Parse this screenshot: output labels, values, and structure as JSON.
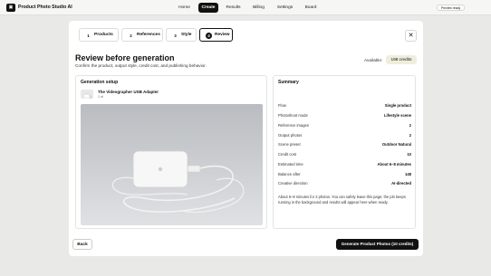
{
  "app": {
    "logo_glyph": "▣",
    "name": "Product Photo Studio AI"
  },
  "nav": [
    {
      "label": "Home"
    },
    {
      "label": "Create"
    },
    {
      "label": "Results"
    },
    {
      "label": "Billing"
    },
    {
      "label": "Settings"
    },
    {
      "label": "Board"
    }
  ],
  "preview_ready": "Preview ready",
  "steps": [
    {
      "num": "1",
      "label": "Products"
    },
    {
      "num": "2",
      "label": "References"
    },
    {
      "num": "3",
      "label": "Style"
    },
    {
      "num": "4",
      "label": "Review"
    }
  ],
  "close_glyph": "✕",
  "page": {
    "title": "Review before generation",
    "subtitle": "Confirm the product, output style, credit cost, and publishing behavior.",
    "available_label": "Available:",
    "available_credits": "198 credits"
  },
  "generation_setup": {
    "title": "Generation setup",
    "product_name": "The Videographer USB Adapter",
    "product_sub": "1 of"
  },
  "summary": {
    "title": "Summary",
    "rows": [
      {
        "key": "Flow",
        "value": "Single product"
      },
      {
        "key": "Photoshoot mode",
        "value": "Lifestyle scene"
      },
      {
        "key": "Reference images",
        "value": "2"
      },
      {
        "key": "Output photos",
        "value": "2"
      },
      {
        "key": "Scene preset",
        "value": "Outdoor Natural"
      },
      {
        "key": "Credit cost",
        "value": "10"
      },
      {
        "key": "Estimated time",
        "value": "About 6–8 minutes"
      },
      {
        "key": "Balance after",
        "value": "148"
      },
      {
        "key": "Creative direction",
        "value": "AI-directed"
      }
    ],
    "note": "About 6–8 minutes for 2 photos. You can safely leave this page; the job keeps running in the background and results will appear here when ready."
  },
  "footer": {
    "back_label": "Back",
    "generate_label": "Generate Product Photos (10 credits)"
  },
  "colors": {
    "accent": "#111111",
    "credits_badge_bg": "#eeeedc",
    "background": "#e9e9e8"
  }
}
